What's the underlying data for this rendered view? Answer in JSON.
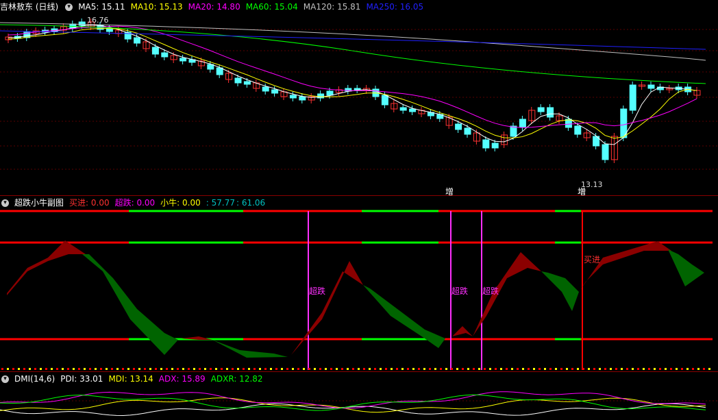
{
  "price_panel": {
    "title": "吉林敖东 (日线)",
    "indicators": [
      {
        "label": "MA5: 15.11",
        "color": "#ffffff"
      },
      {
        "label": "MA10: 15.13",
        "color": "#ffff00"
      },
      {
        "label": "MA20: 14.80",
        "color": "#ff00ff"
      },
      {
        "label": "MA60: 15.04",
        "color": "#00ff00"
      },
      {
        "label": "MA120: 15.81",
        "color": "#c0c0c0"
      },
      {
        "label": "MA250: 16.05",
        "color": "#0000ff"
      }
    ],
    "high_label": "16.76",
    "low_label": "13.13",
    "markers": [
      "增",
      "増"
    ]
  },
  "osc_panel": {
    "title": "超跌小牛副图",
    "indicators": [
      {
        "label": "买进: 0.00",
        "color": "#ff3030"
      },
      {
        "label": "超跌: 0.00",
        "color": "#ff00ff"
      },
      {
        "label": "小牛: 0.00",
        "color": "#ffff00"
      },
      {
        "label": ": 57.77",
        "color": "#00c0c0"
      },
      {
        "label": ": 61.06",
        "color": "#00c0c0"
      }
    ],
    "signals": [
      "超跌",
      "超跌",
      "超跌",
      "买进"
    ]
  },
  "dmi_panel": {
    "title": "DMI(14,6)",
    "indicators": [
      {
        "label": "PDI: 33.01",
        "color": "#ffffff"
      },
      {
        "label": "MDI: 13.14",
        "color": "#ffff00"
      },
      {
        "label": "ADX: 15.89",
        "color": "#ff00ff"
      },
      {
        "label": "ADXR: 12.82",
        "color": "#00ff00"
      }
    ]
  },
  "colors": {
    "up": "#ff3232",
    "down": "#54ffff",
    "grid": "#8a0000",
    "osc_up": "#8b0000",
    "osc_down": "#006400"
  }
}
